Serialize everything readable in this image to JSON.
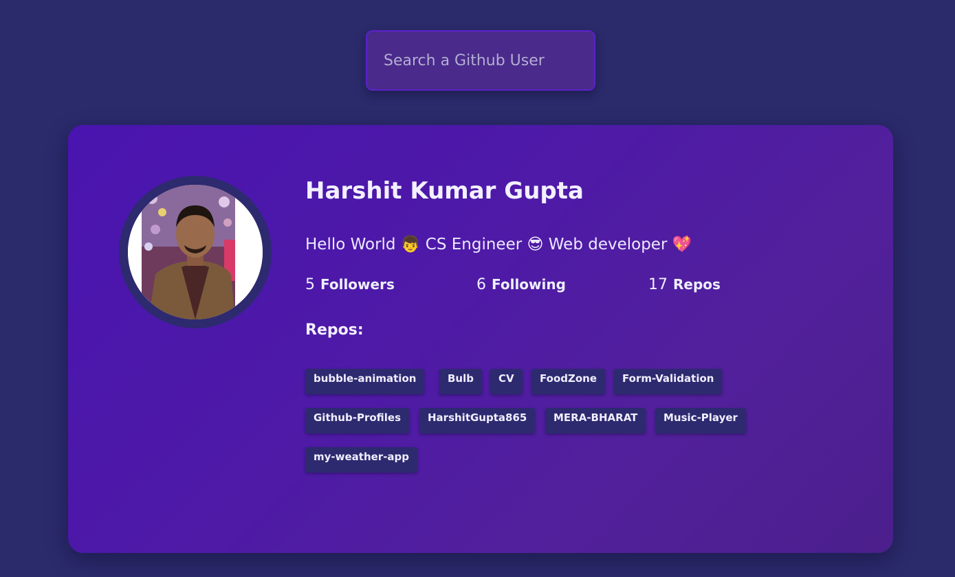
{
  "search": {
    "placeholder": "Search a Github User",
    "value": ""
  },
  "profile": {
    "name": "Harshit Kumar Gupta",
    "bio": "Hello World 👦 CS Engineer 😎 Web developer 💖",
    "stats": {
      "followers": {
        "count": "5",
        "label": "Followers"
      },
      "following": {
        "count": "6",
        "label": "Following"
      },
      "repos": {
        "count": "17",
        "label": "Repos"
      }
    },
    "repos_title": "Repos:",
    "repos": [
      "bubble-animation",
      "Bulb",
      "CV",
      "FoodZone",
      "Form-Validation",
      "Github-Profiles",
      "HarshitGupta865",
      "MERA-BHARAT",
      "Music-Player",
      "my-weather-app"
    ]
  },
  "colors": {
    "background": "#2b2a6b",
    "card_start": "#4a14b0",
    "card_end": "#4b1f8c",
    "tag_bg": "#2d2a70"
  }
}
